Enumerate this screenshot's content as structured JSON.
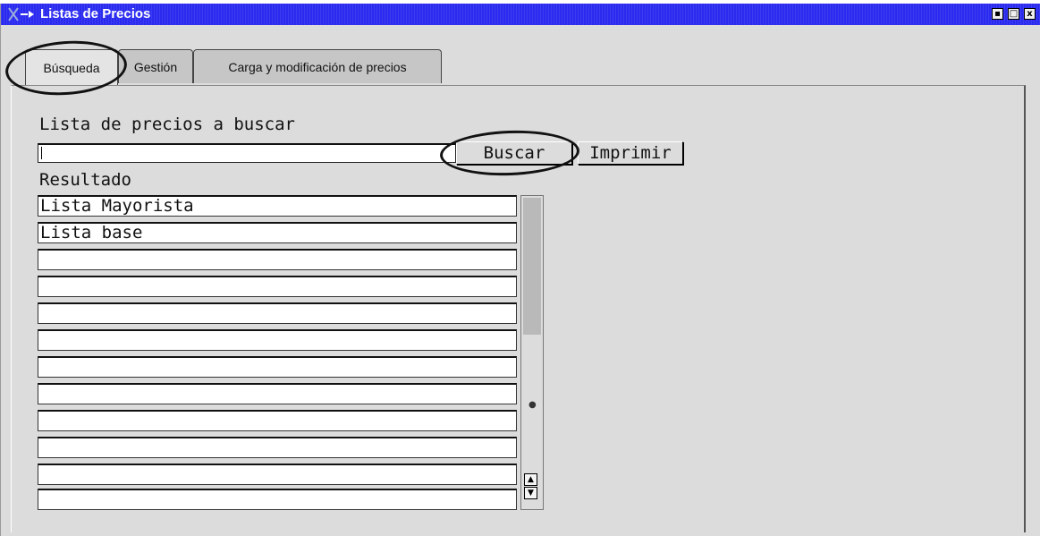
{
  "window": {
    "title": "Listas de Precios",
    "buttons": [
      "▪",
      "□",
      "x"
    ]
  },
  "tabs": [
    {
      "label": "Búsqueda",
      "active": true
    },
    {
      "label": "Gestión",
      "active": false
    },
    {
      "label": "Carga y modificación de precios",
      "active": false
    }
  ],
  "search": {
    "label": "Lista de precios a buscar",
    "value": "",
    "buscar_label": "Buscar",
    "imprimir_label": "Imprimir"
  },
  "results": {
    "label": "Resultado",
    "rows": [
      "Lista Mayorista",
      "Lista base",
      "",
      "",
      "",
      "",
      "",
      "",
      "",
      "",
      "",
      ""
    ]
  },
  "scrollbar": {
    "up_icon": "▲",
    "down_icon": "▼"
  },
  "colors": {
    "titlebar": "#2b2bf0",
    "window_bg": "#dcdcdc"
  }
}
